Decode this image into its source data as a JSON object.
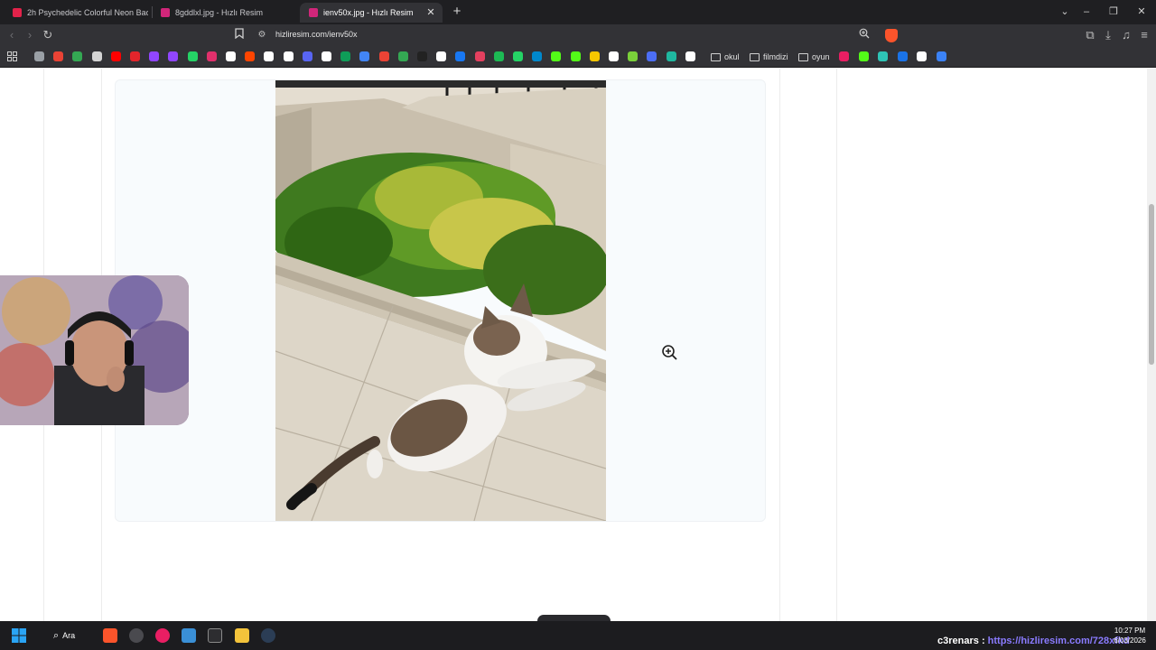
{
  "browser": {
    "tabs": [
      {
        "title": "2h Psychedelic Colorful Neon Backgr",
        "favicon_color": "#e2224a",
        "active": false
      },
      {
        "title": "8gddlxl.jpg - Hızlı Resim",
        "favicon_color": "#d1267a",
        "active": false
      },
      {
        "title": "ienv50x.jpg - Hızlı Resim",
        "favicon_color": "#d1267a",
        "active": true
      }
    ],
    "new_tab_glyph": "+",
    "url": "hizliresim.com/ienv50x",
    "bookmark_folders": [
      "okul",
      "filmdizi",
      "oyun"
    ],
    "bookmark_icon_colors": [
      "#9aa0a6",
      "#ea4335",
      "#34a853",
      "#d4d4d4",
      "#ff0000",
      "#e4252b",
      "#9146ff",
      "#9146ff",
      "#25d366",
      "#e1306c",
      "#ffffff",
      "#ff4500",
      "#ffffff",
      "#ffffff",
      "#5865f2",
      "#ffffff",
      "#0f9d58",
      "#4285f4",
      "#ea4335",
      "#34a853",
      "#222222",
      "#ffffff",
      "#1877f2",
      "#e4405f",
      "#1db954",
      "#25d366",
      "#0088cc",
      "#53fc18",
      "#53fc18",
      "#f7c600",
      "#ffffff",
      "#7ad03a",
      "#4c6ef5",
      "#1fb8a0",
      "#ffffff"
    ],
    "extra_bookmark_colors": [
      "#e91e63",
      "#53fc18",
      "#2ec4b6",
      "#1a73e8",
      "#ffffff",
      "#3b82f6"
    ]
  },
  "page": {
    "image_alt": "Cat on stone pavement next to a bush"
  },
  "taskbar": {
    "search_label": "Ara",
    "stream_user": "c3renars",
    "stream_separator": ":",
    "stream_link": "https://hizliresim.com/728xfkd",
    "time": "10:27 PM",
    "date": "6/03/2026"
  },
  "colors": {
    "accent_pink": "#d1267a",
    "stream_user_color": "#ffffff",
    "stream_link_color": "#8a7bff"
  }
}
